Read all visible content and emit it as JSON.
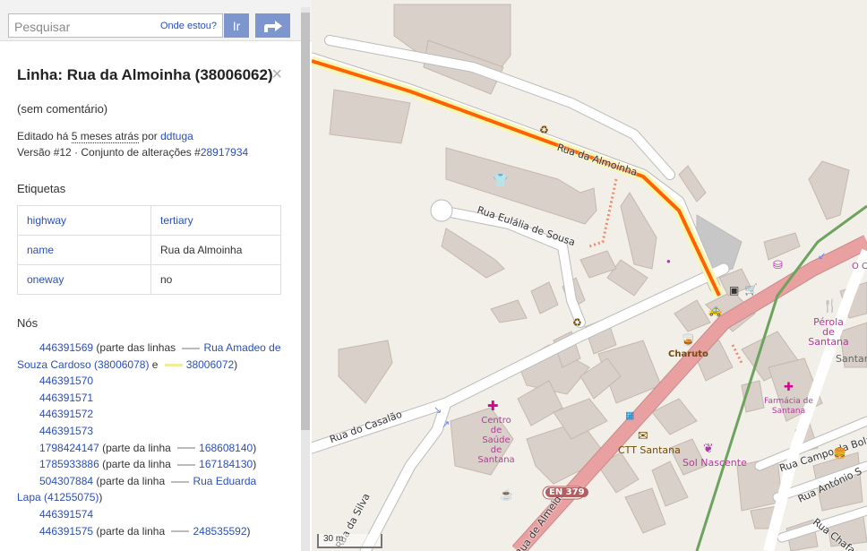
{
  "search": {
    "placeholder": "Pesquisar",
    "where_am_i": "Onde estou?",
    "go_label": "Ir"
  },
  "feature": {
    "title": "Linha: Rua da Almoinha (38006062)",
    "close_icon": "×",
    "comment": "(sem comentário)",
    "edited_prefix": "Editado há ",
    "edited_time": "5 meses atrás",
    "edited_by": " por ",
    "edited_user": "ddtuga",
    "version_prefix": "Versão #12 · Conjunto de alterações #",
    "changeset": "28917934"
  },
  "tags": {
    "heading": "Etiquetas",
    "rows": [
      {
        "key": "highway",
        "value": "tertiary",
        "value_link": true
      },
      {
        "key": "name",
        "value": "Rua da Almoinha",
        "value_link": false
      },
      {
        "key": "oneway",
        "value": "no",
        "value_link": false
      }
    ]
  },
  "nodes": {
    "heading": "Nós",
    "items": [
      {
        "id": "446391569",
        "part_text": " (parte das linhas ",
        "links": [
          "Rua Amadeo de Souza Cardoso (38006078)",
          "38006072"
        ],
        "joiner": " e ",
        "suffix": ")"
      },
      {
        "id": "446391570"
      },
      {
        "id": "446391571"
      },
      {
        "id": "446391572"
      },
      {
        "id": "446391573"
      },
      {
        "id": "1798424147",
        "part_text": " (parte da linha ",
        "links": [
          "168608140"
        ],
        "suffix": ")"
      },
      {
        "id": "1785933886",
        "part_text": " (parte da linha ",
        "links": [
          "167184130"
        ],
        "suffix": ")"
      },
      {
        "id": "504307884",
        "part_text": " (parte da linha ",
        "links": [
          "Rua Eduarda Lapa (41255075)"
        ],
        "suffix": ")"
      },
      {
        "id": "446391574"
      },
      {
        "id": "446391575",
        "part_text": " (parte da linha ",
        "links": [
          "248535592"
        ],
        "suffix": ")"
      }
    ]
  },
  "map": {
    "streets": {
      "almoinha": "Rua da Almoinha",
      "eulalia": "Rua Eulália de Sousa",
      "casalao": "Rua do Casalão",
      "silva": "Rua da Silva",
      "almeida": "Rua de Almeida",
      "campo_bola": "Rua Campo da Bola",
      "antonio": "Rua António S",
      "chafariz": "Rua Chafa"
    },
    "route_shield": "EN 379",
    "pois": {
      "health_center": "Centro de Saúde de Santana",
      "charuto": "Charuto",
      "ctt": "CTT Santana",
      "sol_nascente": "Sol Nascente",
      "perola": "Pérola de Santana",
      "farmacia": "Farmácia de Santana",
      "santana": "Santan",
      "oc": "O C"
    },
    "scale": "30 m",
    "colors": {
      "highlight": "#ff6200",
      "tertiary_road": "#f7f6b5",
      "primary_road": "#e8a0a0",
      "railway": "#6da35e"
    }
  }
}
